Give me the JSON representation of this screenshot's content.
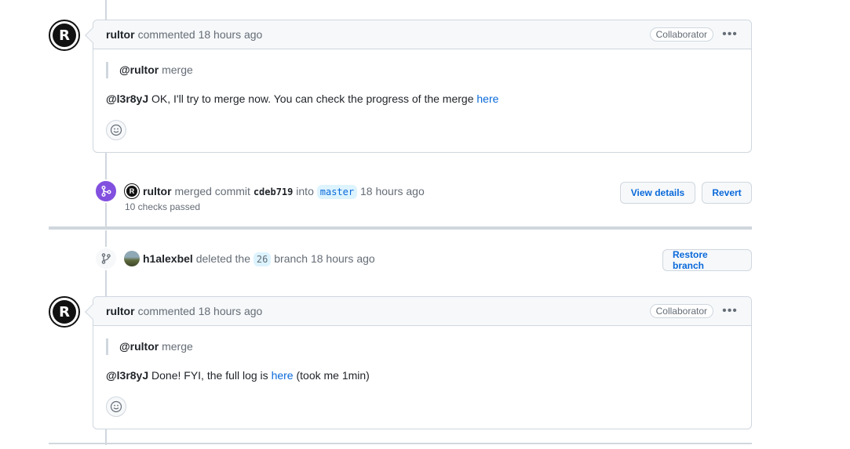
{
  "comments": [
    {
      "author": "rultor",
      "meta": "commented 18 hours ago",
      "badge": "Collaborator",
      "quote_mention": "@rultor",
      "quote_text": "merge",
      "mention": "@l3r8yJ",
      "message": "OK, I'll try to merge now. You can check the progress of the merge",
      "link_text": "here",
      "message_after": ""
    },
    {
      "author": "rultor",
      "meta": "commented 18 hours ago",
      "badge": "Collaborator",
      "quote_mention": "@rultor",
      "quote_text": "merge",
      "mention": "@l3r8yJ",
      "message": "Done! FYI, the full log is",
      "link_text": "here",
      "message_after": "(took me 1min)"
    }
  ],
  "merge_event": {
    "actor": "rultor",
    "action": "merged commit",
    "commit": "cdeb719",
    "into": "into",
    "branch": "master",
    "time": "18 hours ago",
    "checks": "10 checks passed",
    "view_details": "View details",
    "revert": "Revert"
  },
  "delete_event": {
    "actor": "h1alexbel",
    "action": "deleted the",
    "branch": "26",
    "suffix": "branch",
    "time": "18 hours ago",
    "restore": "Restore branch"
  },
  "icons": [
    "kebab-menu-icon",
    "smiley-icon",
    "git-merge-icon",
    "git-branch-icon"
  ],
  "colors": {
    "link": "#0969da",
    "merged": "#8250df",
    "border": "#d0d7de"
  }
}
